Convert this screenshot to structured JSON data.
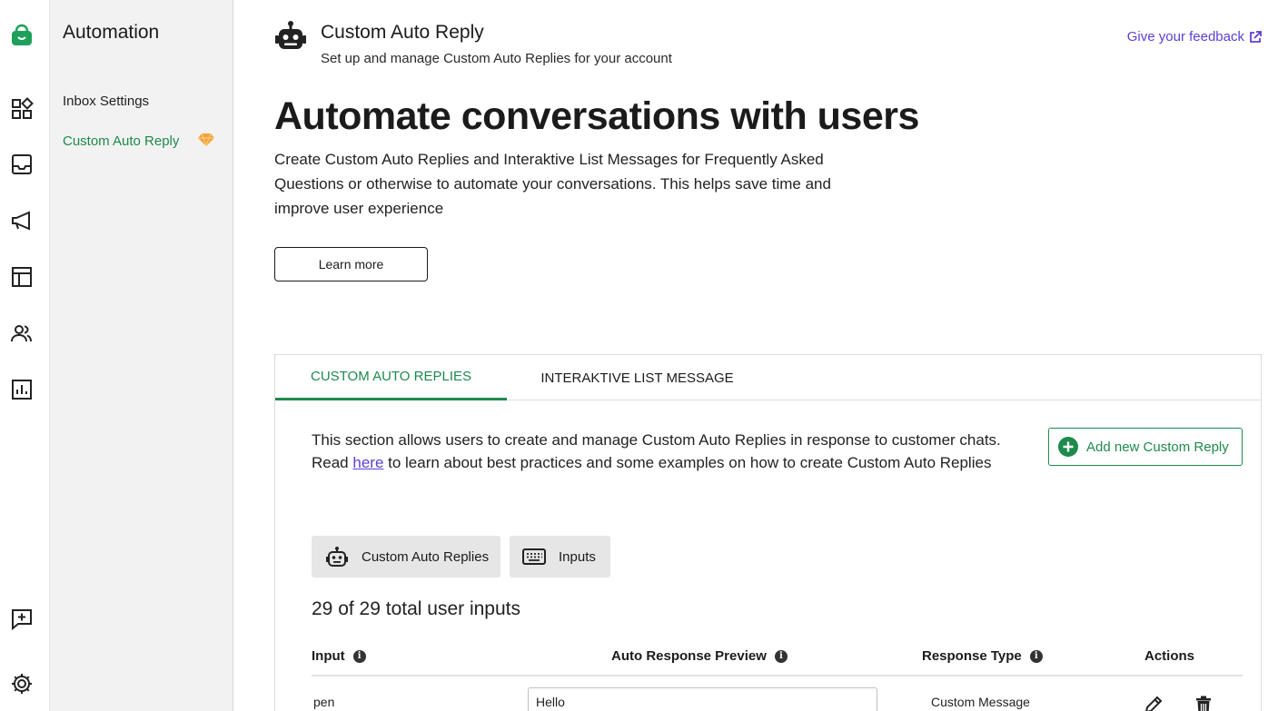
{
  "rail": {
    "items": [
      "logo-icon",
      "apps-icon",
      "inbox-icon",
      "megaphone-icon",
      "table-icon",
      "users-icon",
      "analytics-icon",
      "feedback-chat-icon",
      "settings-icon"
    ]
  },
  "sidebar": {
    "title": "Automation",
    "items": [
      {
        "label": "Inbox Settings"
      },
      {
        "label": "Custom Auto Reply",
        "active": true
      }
    ]
  },
  "header": {
    "title": "Custom Auto Reply",
    "subtitle": "Set up and manage Custom Auto Replies for your account",
    "feedback_label": "Give your feedback"
  },
  "hero": {
    "title": "Automate conversations with users",
    "description": "Create Custom Auto Replies and Interaktive List Messages for Frequently Asked Questions or otherwise to automate your conversations. This helps save time and improve user experience",
    "learn_more": "Learn more"
  },
  "tabs": [
    {
      "label": "CUSTOM AUTO REPLIES",
      "active": true
    },
    {
      "label": "INTERAKTIVE LIST MESSAGE",
      "active": false
    }
  ],
  "section": {
    "desc_before": "This section allows users to create and manage Custom Auto Replies in response to customer chats. Read ",
    "desc_link": "here",
    "desc_after": " to learn about best practices and some examples on how to create Custom Auto Replies",
    "add_button": "Add new Custom Reply"
  },
  "segments": [
    {
      "label": "Custom Auto Replies",
      "icon": "robot-icon"
    },
    {
      "label": "Inputs",
      "icon": "keyboard-icon"
    }
  ],
  "count_text": "29 of 29 total user inputs",
  "table": {
    "columns": [
      "Input",
      "Auto Response Preview",
      "Response Type",
      "Actions"
    ],
    "rows": [
      {
        "input": "pen",
        "preview": "Hello",
        "type": "Custom Message"
      }
    ]
  },
  "colors": {
    "accent_green": "#1d8a4b",
    "link_purple": "#5b3fd6",
    "sidebar_bg": "#f2f2f2"
  }
}
